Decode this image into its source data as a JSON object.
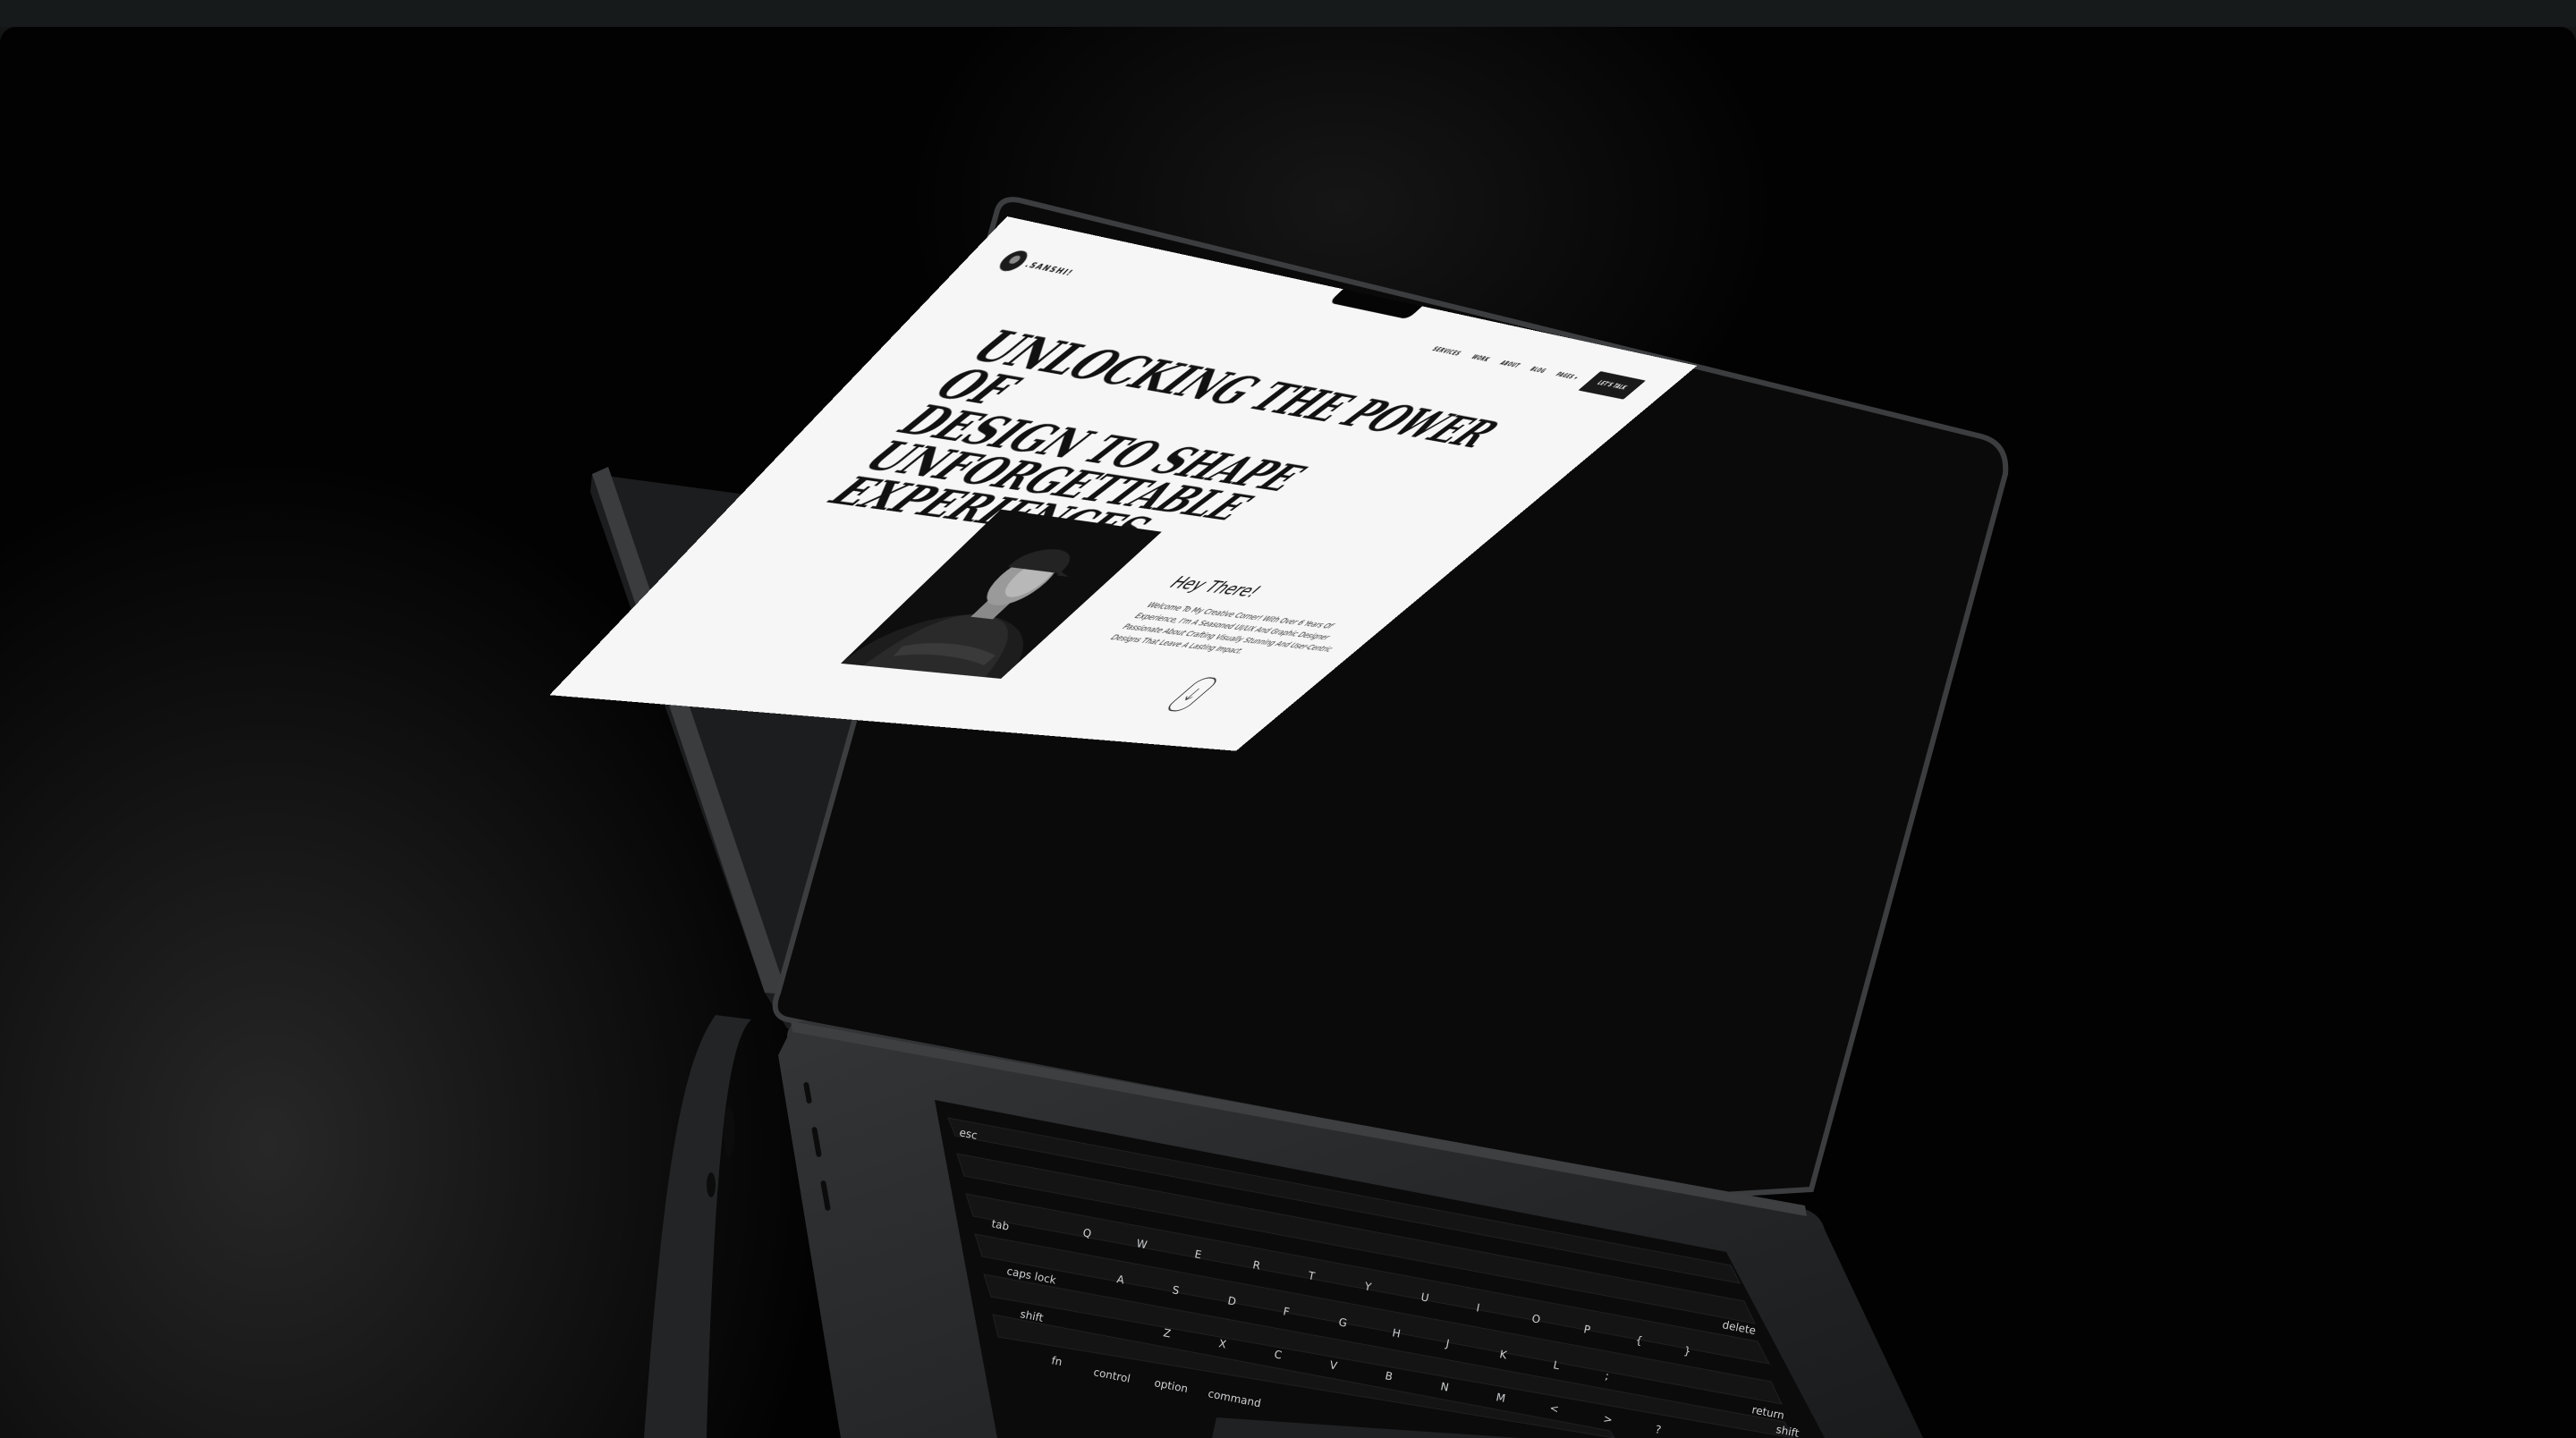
{
  "site": {
    "logo_text": ".SANSHI!",
    "nav": [
      "SERVICES",
      "WORK",
      "ABOUT",
      "BLOG",
      "PAGES ▾"
    ],
    "cta_label": "LET'S TALK"
  },
  "hero": {
    "headline_lines": [
      "Unlocking the power of",
      "design to shape",
      "unforgettable experiences."
    ]
  },
  "intro": {
    "title": "Hey There!",
    "text": "Welcome To My Creative Corner! With Over 6 Years Of Experience, I'm A Seasoned UI/UX And Graphic Designer Passionate About Crafting Visually Stunning And User-Centric Designs That Leave A Lasting Impact."
  },
  "keyboard": {
    "keys_row0": [
      "esc"
    ],
    "keys_row2": [
      "tab",
      "Q",
      "W",
      "E",
      "R",
      "T",
      "Y",
      "U",
      "I",
      "O",
      "P",
      "{",
      "}"
    ],
    "keys_row3": [
      "caps lock",
      "A",
      "S",
      "D",
      "F",
      "G",
      "H",
      "J",
      "K",
      "L",
      ";"
    ],
    "keys_row4": [
      "shift",
      "Z",
      "X",
      "C",
      "V",
      "B",
      "N",
      "M",
      "<",
      ">",
      "?"
    ],
    "keys_row5": [
      "fn",
      "control",
      "option",
      "command"
    ],
    "keys_right": [
      "delete",
      "return",
      "shift"
    ]
  },
  "icons": {
    "scroll": "arrow-down-icon",
    "logo": "avatar-logo-icon"
  },
  "colors": {
    "background": "#020202",
    "screen": "#f6f6f6",
    "ink": "#111111",
    "laptop_body": "#2a2c2e"
  }
}
